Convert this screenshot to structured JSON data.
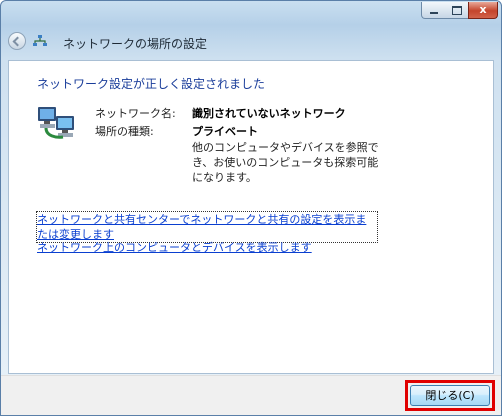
{
  "window": {
    "title": "ネットワークの場所の設定",
    "controls": {
      "close_glyph": "x"
    }
  },
  "content": {
    "heading": "ネットワーク設定が正しく設定されました",
    "network_name_label": "ネットワーク名:",
    "network_name_value": "識別されていないネットワーク",
    "location_type_label": "場所の種類:",
    "location_type_value": "プライベート",
    "description": "他のコンピュータやデバイスを参照でき、お使いのコンピュータも探索可能になります。",
    "links": [
      "ネットワークと共有センターでネットワークと共有の設定を表示または変更します",
      "ネットワーク上のコンピュータとデバイスを表示します"
    ]
  },
  "footer": {
    "close_button_label": "閉じる(C)"
  },
  "icons": {
    "back": "back-arrow-icon",
    "network_small": "network-icon",
    "network_large": "network-computers-icon",
    "minimize": "minimize-icon",
    "maximize": "maximize-icon",
    "close": "close-icon"
  },
  "colors": {
    "highlight": "#e00000",
    "link": "#0a3fd0",
    "heading": "#1a3d9a"
  }
}
